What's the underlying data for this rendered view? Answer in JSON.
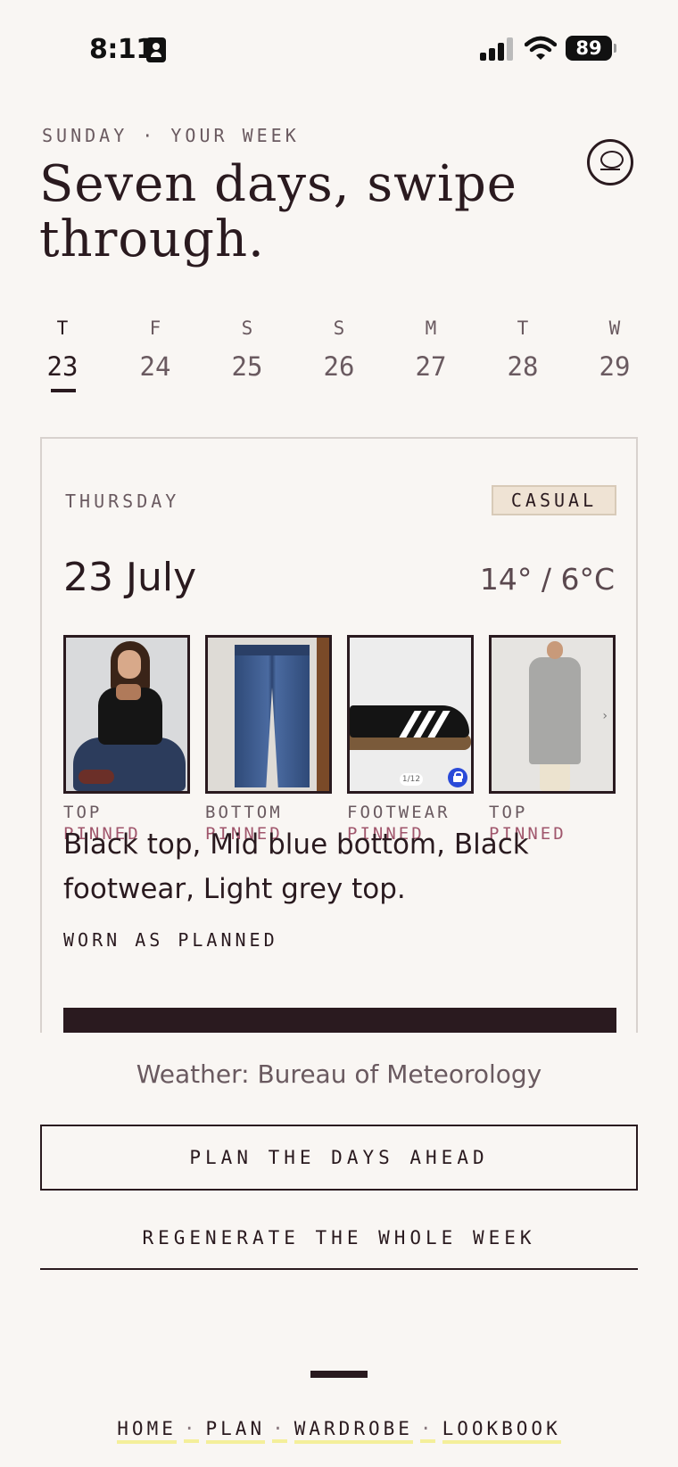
{
  "status_bar": {
    "time": "8:11",
    "battery": "89"
  },
  "header": {
    "eyebrow": "SUNDAY · YOUR WEEK",
    "title": "Seven days, swipe through."
  },
  "week": {
    "days": [
      {
        "dow": "T",
        "num": "23"
      },
      {
        "dow": "F",
        "num": "24"
      },
      {
        "dow": "S",
        "num": "25"
      },
      {
        "dow": "S",
        "num": "26"
      },
      {
        "dow": "M",
        "num": "27"
      },
      {
        "dow": "T",
        "num": "28"
      },
      {
        "dow": "W",
        "num": "29"
      }
    ],
    "active_index": 0
  },
  "card": {
    "day_name": "THURSDAY",
    "badge": "CASUAL",
    "date": "23 July",
    "temp": "14° / 6°C",
    "items": [
      {
        "category": "TOP",
        "state": "PINNED",
        "image": "woman-black-top"
      },
      {
        "category": "BOTTOM",
        "state": "PINNED",
        "image": "blue-jeans"
      },
      {
        "category": "FOOTWEAR",
        "state": "PINNED",
        "image": "black-sneaker",
        "counter": "1/12"
      },
      {
        "category": "TOP",
        "state": "PINNED",
        "image": "grey-cardigan"
      }
    ],
    "description": "Black top, Mid blue bottom, Black footwear, Light grey top.",
    "worn_label": "WORN AS PLANNED"
  },
  "source": "Weather: Bureau of Meteorology",
  "actions": {
    "primary": "PLAN THE DAYS AHEAD",
    "secondary": "REGENERATE THE WHOLE WEEK"
  },
  "nav": {
    "home": "HOME",
    "plan": "PLAN",
    "wardrobe": "WARDROBE",
    "lookbook": "LOOKBOOK",
    "separator": "·"
  },
  "colors": {
    "background": "#f9f6f3",
    "ink": "#2a1a1f",
    "muted": "#6a5a60",
    "pinned": "#a0566c",
    "badge_bg": "#efe3d4",
    "nav_highlight": "#f4ef9a"
  }
}
